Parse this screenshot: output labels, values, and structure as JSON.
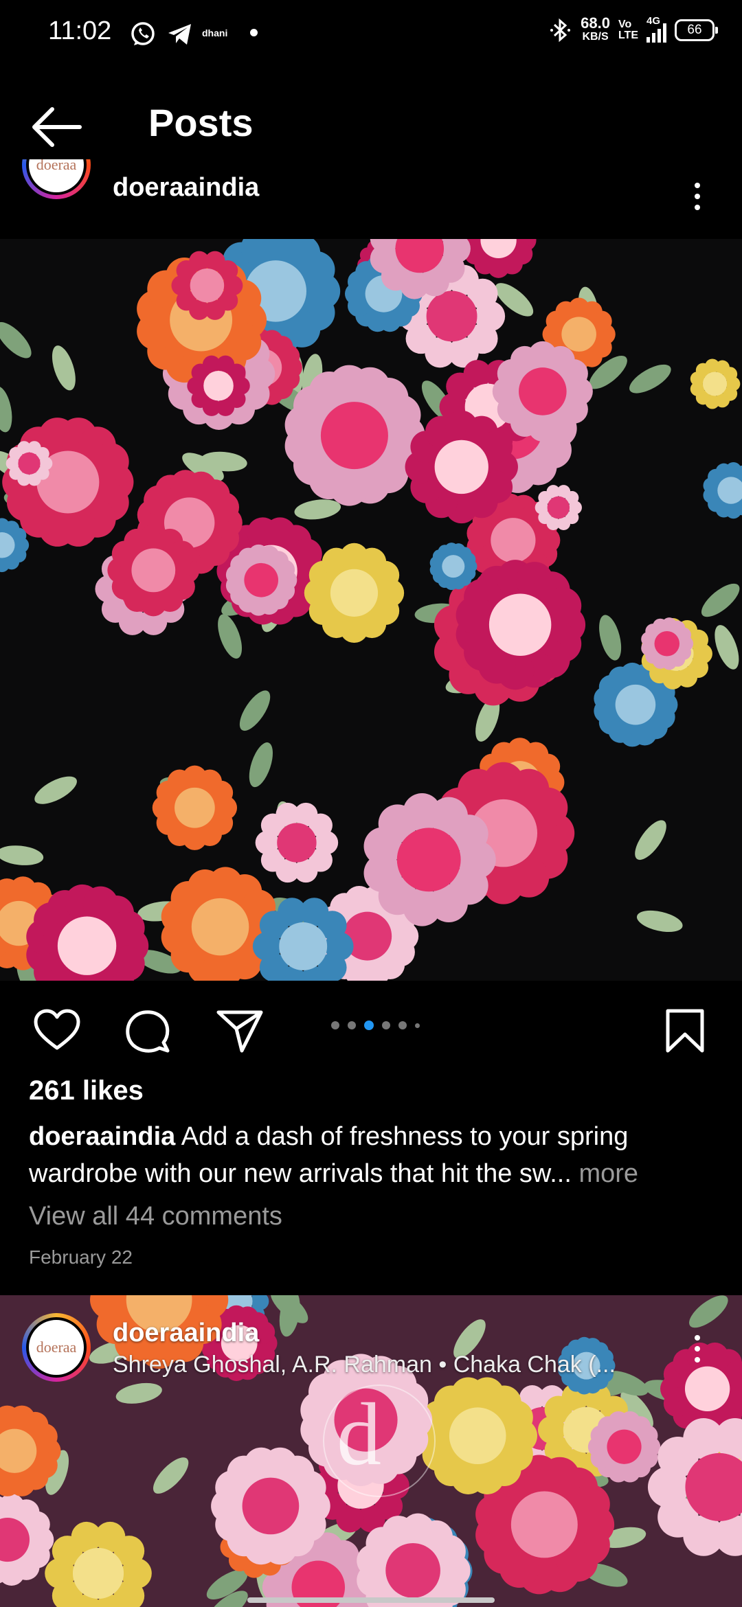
{
  "status_bar": {
    "time": "11:02",
    "app_label": "dhani",
    "speed_value": "68.0",
    "speed_unit": "KB/S",
    "volte_top": "Vo",
    "volte_bottom": "LTE",
    "network": "4G",
    "battery": "66"
  },
  "nav": {
    "title": "Posts"
  },
  "post1": {
    "username": "doeraaindia",
    "avatar_text": "doeraa",
    "likes": "261 likes",
    "caption_user": "doeraaindia",
    "caption_text": " Add a dash of freshness to your spring wardrobe with our new arrivals that hit the sw...",
    "more_label": " more",
    "comments_link": "View all 44 comments",
    "date": "February 22",
    "carousel": {
      "count": 6,
      "active_index": 2
    }
  },
  "post2": {
    "username": "doeraaindia",
    "avatar_text": "doeraa",
    "audio": "Shreya Ghoshal, A.R. Rahman • Chaka Chak (...",
    "watermark": "d"
  },
  "colors": {
    "background": "#000000",
    "accent_blue": "#2196f3",
    "muted_text": "#9a9a9a"
  }
}
